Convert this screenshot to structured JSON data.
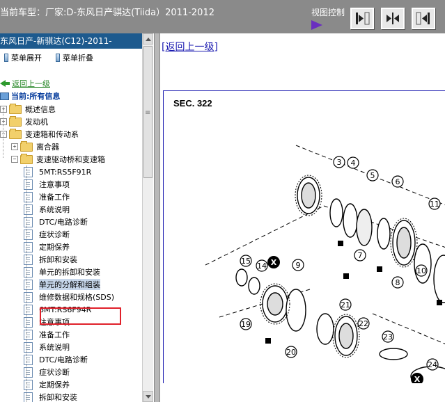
{
  "topbar": {
    "title": "当前车型：厂家:D-东风日产骐达(Tiida）2011-2012",
    "view_label": "视图控制",
    "buttons": [
      "right-panel-icon",
      "split-panel-icon",
      "left-panel-icon"
    ]
  },
  "left": {
    "header": "东风日产-新骐达(C12)-2011-",
    "expand_label": "菜单展开",
    "collapse_label": "菜单折叠",
    "back_label": "返回上一级",
    "current_label": "当前:所有信息"
  },
  "tree": [
    {
      "label": "概述信息",
      "type": "folder",
      "level": 0
    },
    {
      "label": "发动机",
      "type": "folder",
      "level": 0
    },
    {
      "label": "变速箱和传动系",
      "type": "folder",
      "level": 0
    },
    {
      "label": "离合器",
      "type": "folder",
      "level": 1
    },
    {
      "label": "变速驱动桥和变速箱",
      "type": "folder",
      "level": 1
    },
    {
      "label": "5MT:RS5F91R",
      "type": "doc",
      "level": 2
    },
    {
      "label": "注意事项",
      "type": "doc",
      "level": 2
    },
    {
      "label": "准备工作",
      "type": "doc",
      "level": 2
    },
    {
      "label": "系统说明",
      "type": "doc",
      "level": 2
    },
    {
      "label": "DTC/电路诊断",
      "type": "doc",
      "level": 2
    },
    {
      "label": "症状诊断",
      "type": "doc",
      "level": 2
    },
    {
      "label": "定期保养",
      "type": "doc",
      "level": 2
    },
    {
      "label": "拆卸和安装",
      "type": "doc",
      "level": 2
    },
    {
      "label": "单元的拆卸和安装",
      "type": "doc",
      "level": 2
    },
    {
      "label": "单元的分解和组装",
      "type": "doc",
      "level": 2,
      "selected": true
    },
    {
      "label": "维修数据和规格(SDS)",
      "type": "doc",
      "level": 2
    },
    {
      "label": "6MT:RS6F94R",
      "type": "doc",
      "level": 2
    },
    {
      "label": "注意事项",
      "type": "doc",
      "level": 2
    },
    {
      "label": "准备工作",
      "type": "doc",
      "level": 2
    },
    {
      "label": "系统说明",
      "type": "doc",
      "level": 2
    },
    {
      "label": "DTC/电路诊断",
      "type": "doc",
      "level": 2
    },
    {
      "label": "症状诊断",
      "type": "doc",
      "level": 2
    },
    {
      "label": "定期保养",
      "type": "doc",
      "level": 2
    },
    {
      "label": "拆卸和安装",
      "type": "doc",
      "level": 2
    }
  ],
  "content": {
    "uplink": "[返回上一级]",
    "section": "SEC. 322",
    "callouts": [
      "3",
      "4",
      "5",
      "6",
      "7",
      "8",
      "9",
      "10",
      "11",
      "14",
      "15",
      "19",
      "20",
      "21",
      "22",
      "23",
      "24"
    ]
  }
}
